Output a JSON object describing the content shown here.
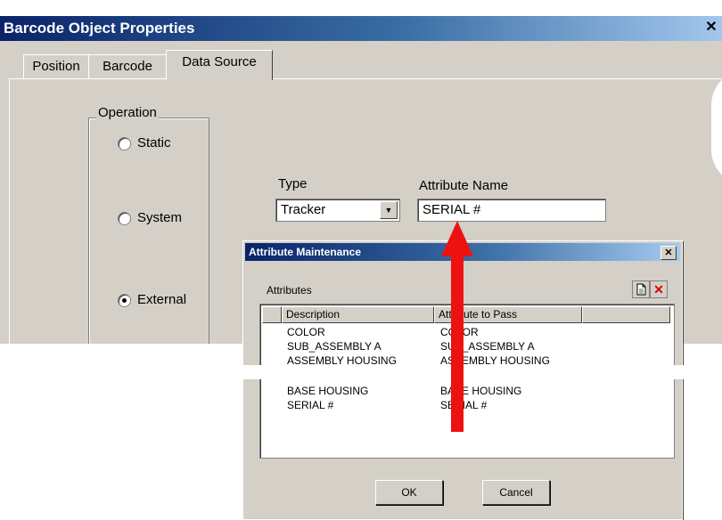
{
  "main_window": {
    "title": "Barcode Object Properties",
    "close_glyph": "✕",
    "tabs": [
      {
        "label": "Position"
      },
      {
        "label": "Barcode"
      },
      {
        "label": "Data Source"
      }
    ],
    "operation": {
      "legend": "Operation",
      "options": [
        {
          "label": "Static",
          "selected": false
        },
        {
          "label": "System",
          "selected": false
        },
        {
          "label": "External",
          "selected": true
        }
      ]
    },
    "type": {
      "label": "Type",
      "value": "Tracker",
      "arrow": "▼"
    },
    "attribute_name": {
      "label": "Attribute Name",
      "value": "SERIAL #"
    }
  },
  "dialog": {
    "title": "Attribute Maintenance",
    "close_glyph": "✕",
    "attributes_label": "Attributes",
    "toolbar": {
      "new_icon": "new-document-icon",
      "delete_icon": "delete-icon",
      "delete_glyph": "✕"
    },
    "columns": [
      "Description",
      "Attribute to Pass"
    ],
    "rows": [
      {
        "description": "COLOR",
        "pass": "COLOR"
      },
      {
        "description": "SUB_ASSEMBLY A",
        "pass": "SUB_ASSEMBLY A"
      },
      {
        "description": "ASSEMBLY HOUSING",
        "pass": "ASSEMBLY HOUSING"
      },
      {
        "description": "BASE HOUSING",
        "pass": "BASE HOUSING"
      },
      {
        "description": "SERIAL #",
        "pass": "SERIAL #"
      }
    ],
    "ok_label": "OK",
    "cancel_label": "Cancel"
  },
  "colors": {
    "window_bg": "#d4d0c8",
    "title_gradient_start": "#0a246a",
    "arrow": "#ee1111"
  }
}
